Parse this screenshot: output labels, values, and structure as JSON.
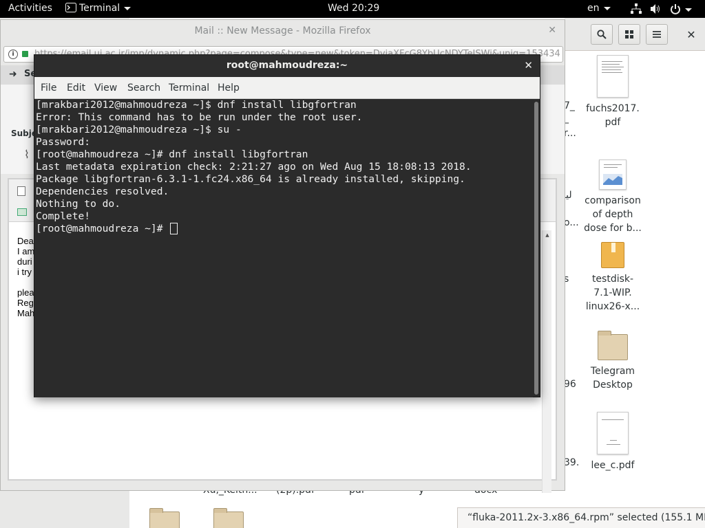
{
  "topbar": {
    "activities": "Activities",
    "app_menu": "Terminal",
    "clock": "Wed 20:29",
    "language": "en"
  },
  "file_manager": {
    "desktop_files": [
      {
        "label": "fuchs2017.\npdf",
        "icon": "pdf-document-icon"
      },
      {
        "label": "comparison\nof depth\ndose for b...",
        "icon": "spreadsheet-document-icon"
      },
      {
        "label": "testdisk-\n7.1-WIP.\nlinux26-x...",
        "icon": "package-icon"
      },
      {
        "label": "Telegram\nDesktop",
        "icon": "folder-icon"
      },
      {
        "label": "lee_c.pdf",
        "icon": "pdf-document-icon"
      }
    ],
    "partial_labels": [
      "Xu,_Keith...",
      "(2p).pdf",
      "pdf",
      "y",
      "docx",
      "7_",
      "_",
      "r...",
      "ion",
      "ليـ",
      "o...",
      "s",
      "96",
      "39."
    ],
    "status": "“fluka-2011.2x-3.x86_64.rpm” selected  (155.1 MB)"
  },
  "firefox": {
    "title": "Mail :: New Message - Mozilla Firefox",
    "url": "https://email.ui.ac.ir/imp/dynamic.php?page=compose&type=new&token=DviaXFcG8YbUcNDYTeISWi&uniq=153434",
    "send_label": "Se",
    "subject_label": "Subje",
    "body_lines": [
      "Dea",
      "I am",
      "duri",
      "i try",
      "",
      "plea",
      "Reg",
      "Mah"
    ]
  },
  "terminal": {
    "title": "root@mahmoudreza:~",
    "menu": [
      "File",
      "Edit",
      "View",
      "Search",
      "Terminal",
      "Help"
    ],
    "lines": [
      "[mrakbari2012@mahmoudreza ~]$ dnf install libgfortran",
      "Error: This command has to be run under the root user.",
      "[mrakbari2012@mahmoudreza ~]$ su -",
      "Password:",
      "[root@mahmoudreza ~]# dnf install libgfortran",
      "Last metadata expiration check: 2:21:27 ago on Wed Aug 15 18:08:13 2018.",
      "Package libgfortran-6.3.1-1.fc24.x86_64 is already installed, skipping.",
      "Dependencies resolved.",
      "Nothing to do.",
      "Complete!"
    ],
    "prompt": "[root@mahmoudreza ~]# "
  },
  "colors": {
    "topbar_bg": "#000000",
    "terminal_bg": "#2b2b2b",
    "terminal_fg": "#f0f0f0"
  }
}
